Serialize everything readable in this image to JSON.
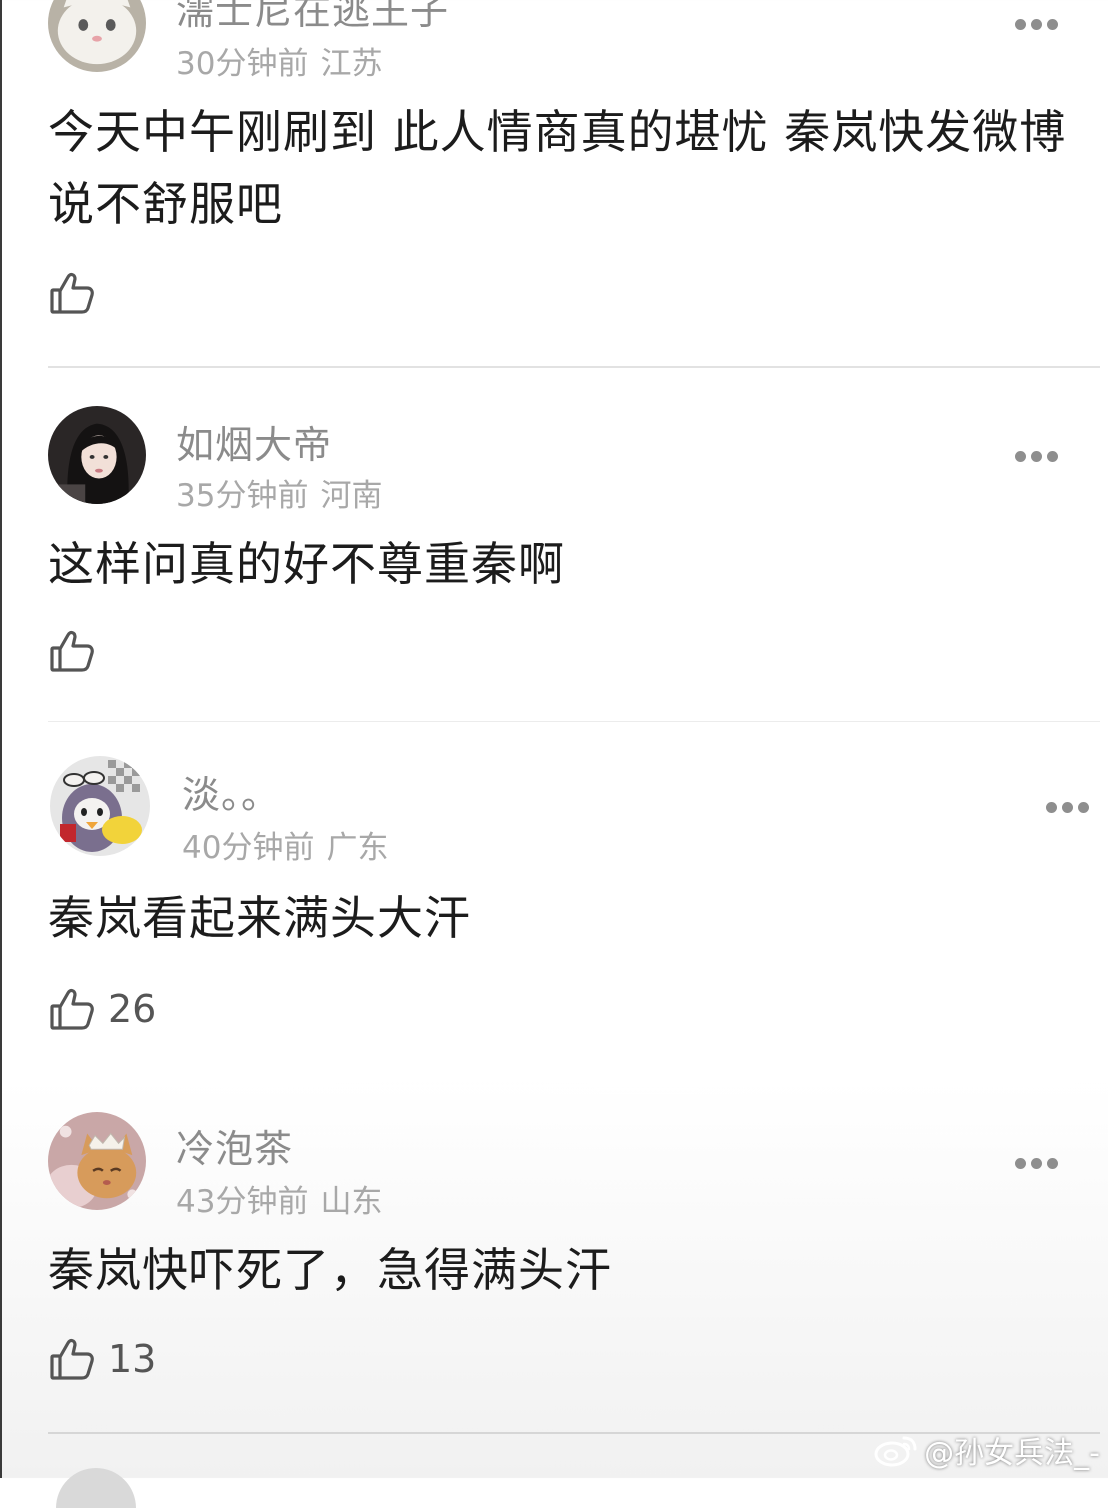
{
  "comments": [
    {
      "username": "濡士尼在逃王子",
      "time": "30分钟前",
      "location": "江苏",
      "text": "今天中午刚刷到 此人情商真的堪忧 秦岚快发微博说不舒服吧",
      "likes": "",
      "avatar_icon": "white-cat-avatar-icon"
    },
    {
      "username": "如烟大帝",
      "time": "35分钟前",
      "location": "河南",
      "text": "这样问真的好不尊重秦啊",
      "likes": "",
      "avatar_icon": "woman-portrait-avatar-icon"
    },
    {
      "username": "淡。。",
      "time": "40分钟前",
      "location": "广东",
      "text": "秦岚看起来满头大汗",
      "likes": "26",
      "avatar_icon": "penguin-plush-avatar-icon"
    },
    {
      "username": "冷泡茶",
      "time": "43分钟前",
      "location": "山东",
      "text": "秦岚快吓死了，急得满头汗",
      "likes": "13",
      "avatar_icon": "cat-crown-avatar-icon"
    }
  ],
  "icons": {
    "like": "thumbs-up-icon",
    "more": "more-dots-icon",
    "watermark": "weibo-logo-icon"
  },
  "watermark": {
    "text": "@孙女兵法_-"
  }
}
